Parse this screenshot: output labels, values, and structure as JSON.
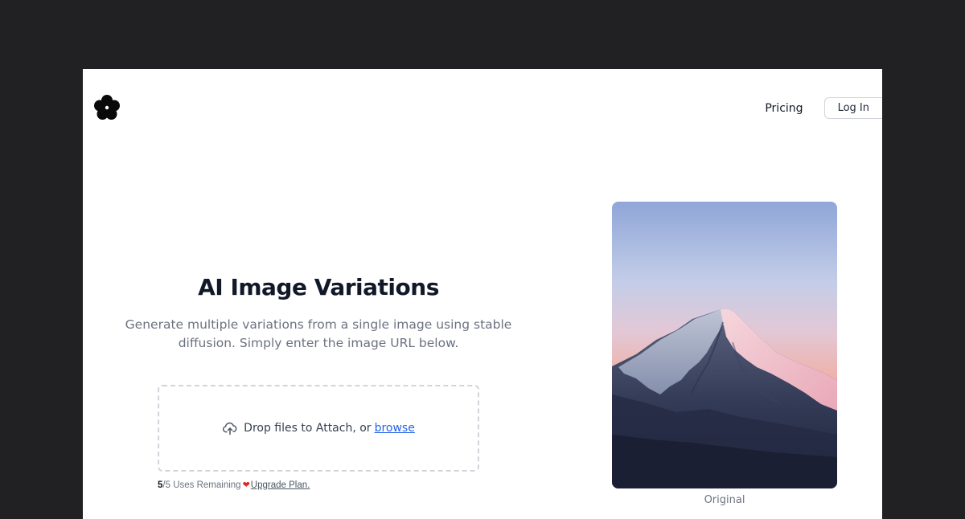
{
  "header": {
    "logo_icon": "flower-icon",
    "nav": {
      "pricing_label": "Pricing",
      "login_label": "Log In"
    }
  },
  "hero": {
    "title": "AI Image Variations",
    "subtitle": "Generate multiple variations from a single image using stable diffusion. Simply enter the image URL below."
  },
  "upload": {
    "icon": "upload-cloud-icon",
    "prompt": "Drop files to Attach, or",
    "browse_label": "browse"
  },
  "usage": {
    "remaining": "5",
    "total_text": "/5 Uses Remaining",
    "heart_icon": "heart-icon",
    "upgrade_label": "Upgrade Plan."
  },
  "preview": {
    "caption": "Original",
    "image_subject": "mountain-peak-at-sunset"
  },
  "colors": {
    "page_background": "#212124",
    "card_background": "#ffffff",
    "accent_link": "#2563eb",
    "heart": "#dc2626",
    "title": "#111827",
    "muted_text": "#6b7280"
  }
}
